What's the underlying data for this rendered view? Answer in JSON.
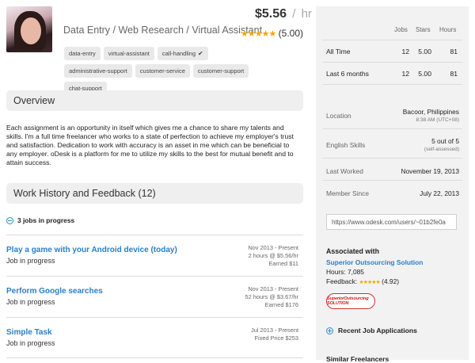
{
  "profile": {
    "title": "Data Entry / Web Research / Virtual Assistant",
    "rate": "$5.56",
    "rate_separator": "/",
    "rate_unit": "hr",
    "stars": "★★★★★",
    "rating": "(5.00)",
    "tags": [
      "data-entry",
      "virtual-assistant",
      "call-handling",
      "administrative-support",
      "customer-service",
      "customer-support",
      "chat-support"
    ],
    "tag_check": "✔"
  },
  "overview": {
    "heading": "Overview",
    "text": "Each assignment is an opportunity in itself which gives me a chance to share my talents and skills. I'm a full time freelancer who works to a state of perfection to achieve my employer's trust and satisfaction. Dedication to work with accuracy is an asset in me which can be beneficial to any employer. oDesk is a platform for me to utilize my skills to the best for mutual benefit and to attain success."
  },
  "work_history": {
    "heading": "Work History and Feedback (12)",
    "in_progress_label": "3 jobs in progress",
    "jobs": [
      {
        "name": "Play a game with your Android device (today)",
        "status": "Job in progress",
        "dates": "Nov 2013 - Present",
        "rate": "2 hours @ $5.56/hr",
        "earned": "Earned $11"
      },
      {
        "name": "Perform Google searches",
        "status": "Job in progress",
        "dates": "Nov 2013 - Present",
        "rate": "52 hours @ $3.67/hr",
        "earned": "Earned $176"
      },
      {
        "name": "Simple Task",
        "status": "Job in progress",
        "dates": "Jul 2013 - Present",
        "rate": "Fixed Price $253",
        "earned": ""
      }
    ]
  },
  "sidebar": {
    "stats_headers": {
      "jobs": "Jobs",
      "stars": "Stars",
      "hours": "Hours"
    },
    "stats_rows": [
      {
        "label": "All Time",
        "jobs": "12",
        "stars": "5.00",
        "hours": "81"
      },
      {
        "label": "Last 6 months",
        "jobs": "12",
        "stars": "5.00",
        "hours": "81"
      }
    ],
    "location_label": "Location",
    "location": "Bacoor, Philippines",
    "location_time": "8:38 AM (UTC+08)",
    "english_label": "English Skills",
    "english": "5 out of 5",
    "english_sub": "(self-assessed)",
    "last_worked_label": "Last Worked",
    "last_worked": "November 19, 2013",
    "member_since_label": "Member Since",
    "member_since": "July 22, 2013",
    "profile_url": "https://www.odesk.com/users/~01b2fe0a",
    "associated_title": "Associated with",
    "agency_name": "Superior Outsourcing Solution",
    "agency_hours": "Hours: 7,085",
    "agency_feedback_label": "Feedback:",
    "agency_stars": "★★★★★",
    "agency_feedback": "(4.92)",
    "agency_logo_text": "SuperiorOutsourcing SOLUTION",
    "recent_applications": "Recent Job Applications",
    "similar_freelancers": "Similar Freelancers"
  },
  "colors": {
    "link": "#2a7fc9",
    "star": "#f0a800",
    "panel": "#f2f2f2"
  }
}
